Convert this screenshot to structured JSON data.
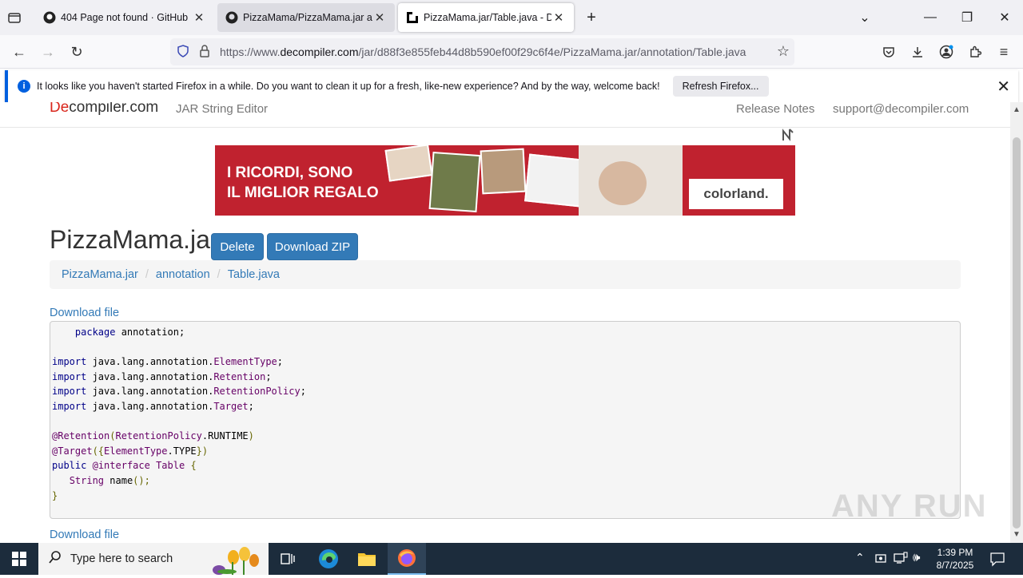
{
  "tabs": [
    {
      "label": "404 Page not found · GitHub",
      "icon": "github-icon",
      "active": false
    },
    {
      "label": "PizzaMama/PizzaMama.jar at ma",
      "icon": "github-icon",
      "active": false
    },
    {
      "label": "PizzaMama.jar/Table.java - Deco",
      "icon": "decompiler-icon",
      "active": true
    }
  ],
  "url": {
    "prefix": "https://www.",
    "domain": "decompiler.com",
    "path": "/jar/d88f3e855feb44d8b590ef00f29c6f4e/PizzaMama.jar/annotation/Table.java"
  },
  "notification": {
    "message": "It looks like you haven't started Firefox in a while. Do you want to clean it up for a fresh, like-new experience? And by the way, welcome back!",
    "button": "Refresh Firefox..."
  },
  "site": {
    "brand_de": "De",
    "brand_rest": "compiler.com",
    "nav_left": "JAR String Editor",
    "nav_release": "Release Notes",
    "nav_support": "support@decompiler.com"
  },
  "ad": {
    "line1": "I RICORDI, SONO",
    "line2": "IL MIGLIOR REGALO",
    "logo": "colorland."
  },
  "page": {
    "title": "PizzaMama.jar",
    "delete_label": "Delete",
    "download_zip_label": "Download ZIP",
    "download_file_label": "Download file"
  },
  "breadcrumb": [
    "PizzaMama.jar",
    "annotation",
    "Table.java"
  ],
  "taskbar": {
    "search_placeholder": "Type here to search",
    "time": "1:39 PM",
    "date": "8/7/2025"
  },
  "watermark": "ANY RUN",
  "colors": {
    "link": "#337ab7",
    "button": "#337ab7",
    "ad_bg": "#c0222f",
    "taskbar": "#1c2c3c"
  }
}
